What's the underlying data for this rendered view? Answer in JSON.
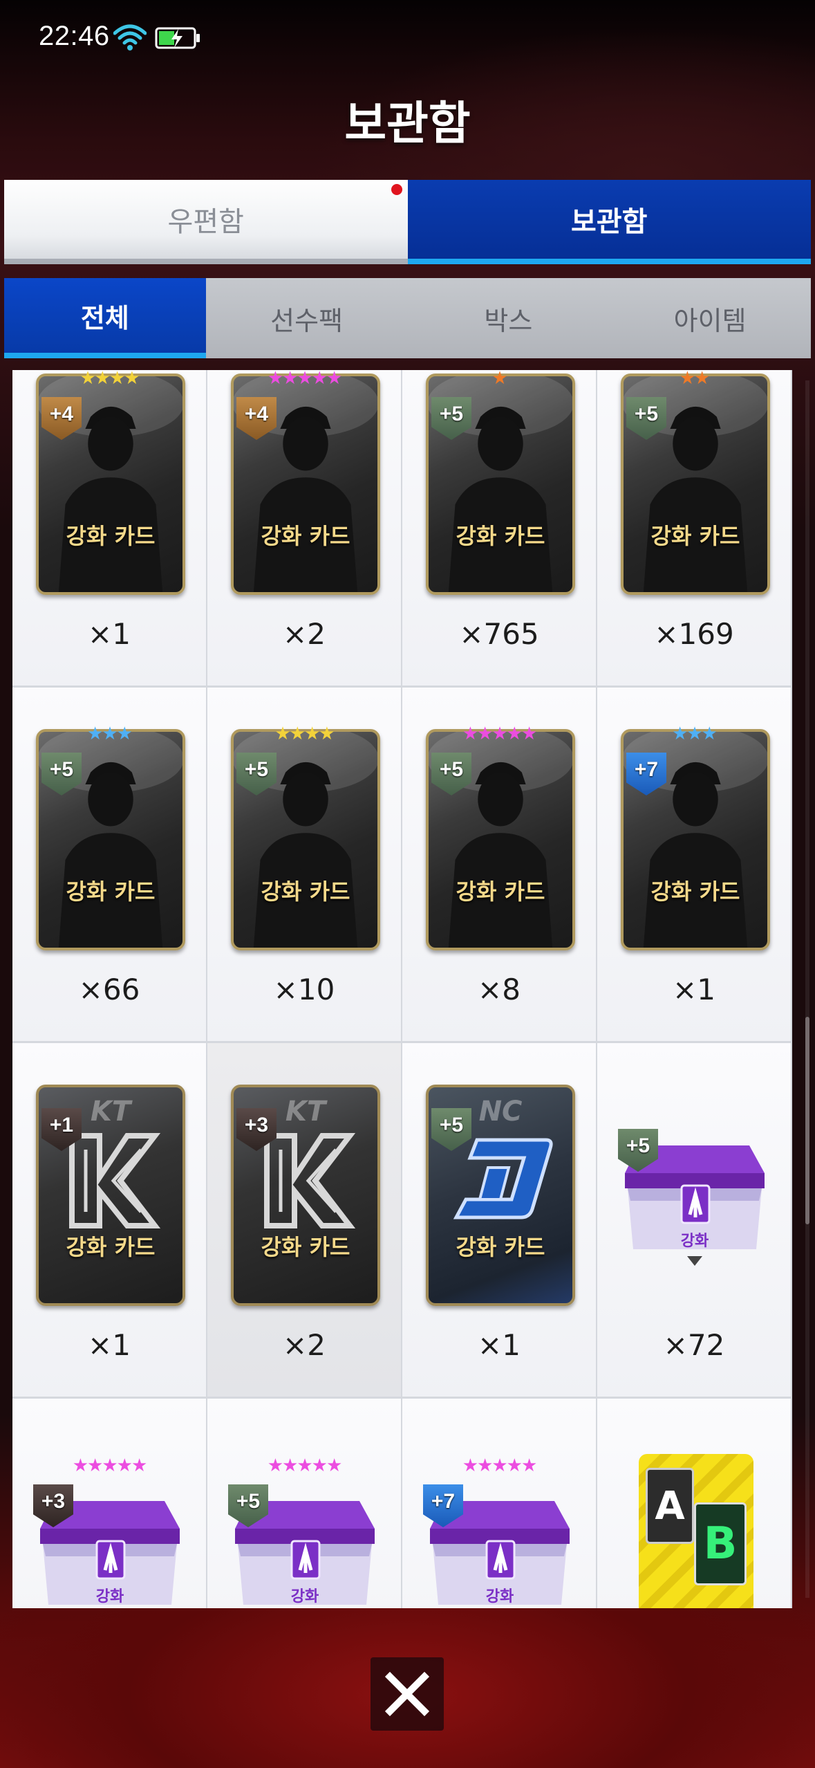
{
  "status_bar": {
    "time": "22:46",
    "wifi_icon": "wifi-icon",
    "battery_icon": "battery-charging-icon"
  },
  "header": {
    "title": "보관함"
  },
  "top_tabs": [
    {
      "label": "우편함",
      "active": false,
      "has_notification": true
    },
    {
      "label": "보관함",
      "active": true,
      "has_notification": false
    }
  ],
  "sub_tabs": [
    {
      "label": "전체",
      "active": true
    },
    {
      "label": "선수팩",
      "active": false
    },
    {
      "label": "박스",
      "active": false
    },
    {
      "label": "아이템",
      "active": false
    }
  ],
  "items": [
    {
      "type": "player-card",
      "label": "강화 카드",
      "level": "+4",
      "stars": 4,
      "star_color": "gold",
      "quantity": "×1"
    },
    {
      "type": "player-card",
      "label": "강화 카드",
      "level": "+4",
      "stars": 5,
      "star_color": "pink",
      "quantity": "×2"
    },
    {
      "type": "player-card",
      "label": "강화 카드",
      "level": "+5",
      "stars": 1,
      "star_color": "orange",
      "quantity": "×765"
    },
    {
      "type": "player-card",
      "label": "강화 카드",
      "level": "+5",
      "stars": 2,
      "star_color": "orange",
      "quantity": "×169"
    },
    {
      "type": "player-card",
      "label": "강화 카드",
      "level": "+5",
      "stars": 3,
      "star_color": "blue",
      "quantity": "×66"
    },
    {
      "type": "player-card",
      "label": "강화 카드",
      "level": "+5",
      "stars": 4,
      "star_color": "gold",
      "quantity": "×10"
    },
    {
      "type": "player-card",
      "label": "강화 카드",
      "level": "+5",
      "stars": 5,
      "star_color": "pink",
      "quantity": "×8"
    },
    {
      "type": "player-card",
      "label": "강화 카드",
      "level": "+7",
      "stars": 3,
      "star_color": "blue",
      "quantity": "×1"
    },
    {
      "type": "team-card",
      "team": "KT",
      "label": "강화 카드",
      "level": "+1",
      "quantity": "×1"
    },
    {
      "type": "team-card",
      "team": "KT",
      "label": "강화 카드",
      "level": "+3",
      "quantity": "×2"
    },
    {
      "type": "team-card",
      "team": "NC",
      "label": "강화 카드",
      "level": "+5",
      "quantity": "×1"
    },
    {
      "type": "chest",
      "label": "강화",
      "level": "+5",
      "stars": 0,
      "quantity": "×72"
    },
    {
      "type": "chest",
      "label": "강화",
      "level": "+3",
      "stars": 5,
      "star_color": "pink",
      "quantity": ""
    },
    {
      "type": "chest",
      "label": "강화",
      "level": "+5",
      "stars": 5,
      "star_color": "pink",
      "quantity": ""
    },
    {
      "type": "chest",
      "label": "강화",
      "level": "+7",
      "stars": 5,
      "star_color": "pink",
      "quantity": ""
    },
    {
      "type": "ab-card",
      "label_a": "A",
      "label_b": "B",
      "quantity": ""
    }
  ],
  "close_button": {
    "icon": "close-icon"
  }
}
